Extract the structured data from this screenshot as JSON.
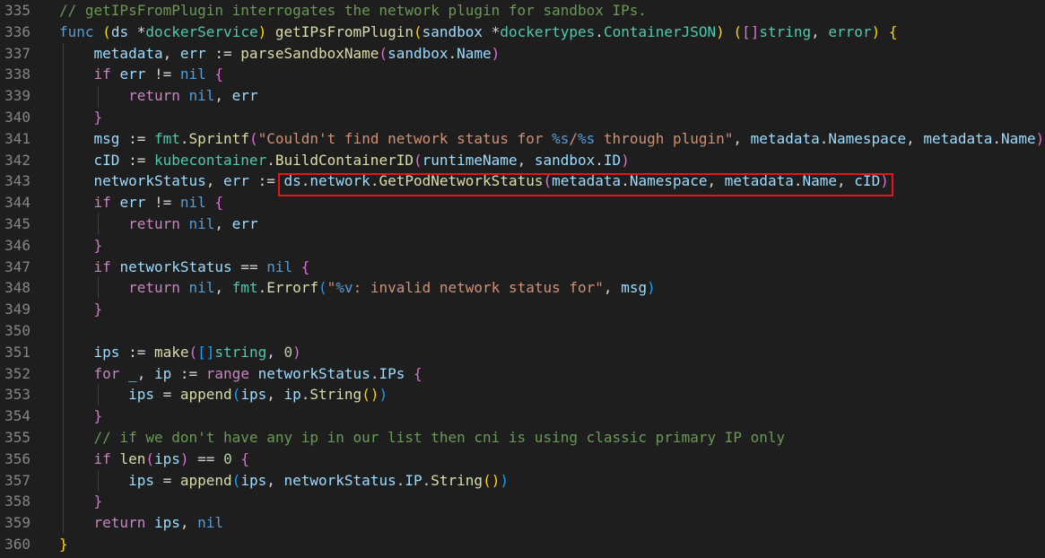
{
  "colors": {
    "background": "#1e1e1e",
    "line_number": "#858585",
    "keyword": "#569cd6",
    "control": "#c586c0",
    "function": "#dcdcaa",
    "variable": "#9cdcfe",
    "type": "#4ec9b0",
    "string": "#ce9178",
    "number": "#b5cea8",
    "comment": "#6a9955",
    "highlight_box": "#e3141b"
  },
  "lines": [
    {
      "n": "335",
      "indent": 0,
      "tokens": [
        [
          "// getIPsFromPlugin interrogates the network plugin for sandbox IPs.",
          "cmt"
        ]
      ]
    },
    {
      "n": "336",
      "indent": 0,
      "tokens": [
        [
          "func",
          "kw"
        ],
        [
          " ",
          ""
        ],
        [
          "(",
          "b1"
        ],
        [
          "ds ",
          "var"
        ],
        [
          "*",
          "op"
        ],
        [
          "dockerService",
          "type"
        ],
        [
          "",
          "b1"
        ],
        [
          ") ",
          "b1"
        ],
        [
          "getIPsFromPlugin",
          "fn"
        ],
        [
          "(",
          "b1"
        ],
        [
          "sandbox ",
          "var"
        ],
        [
          "*",
          "op"
        ],
        [
          "dockertypes",
          "type"
        ],
        [
          ".",
          "op"
        ],
        [
          "ContainerJSON",
          "type"
        ],
        [
          ") ",
          "b1"
        ],
        [
          "(",
          "b1"
        ],
        [
          "[]",
          "b2"
        ],
        [
          "string",
          "type"
        ],
        [
          ", ",
          "op"
        ],
        [
          "error",
          "type"
        ],
        [
          ") ",
          "b1"
        ],
        [
          "{",
          "b1"
        ]
      ]
    },
    {
      "n": "337",
      "indent": 1,
      "tokens": [
        [
          "metadata",
          "var"
        ],
        [
          ", ",
          "op"
        ],
        [
          "err",
          "var"
        ],
        [
          " := ",
          "op"
        ],
        [
          "parseSandboxName",
          "fn"
        ],
        [
          "(",
          "b2"
        ],
        [
          "sandbox",
          "var"
        ],
        [
          ".",
          "op"
        ],
        [
          "Name",
          "var"
        ],
        [
          ")",
          "b2"
        ]
      ]
    },
    {
      "n": "338",
      "indent": 1,
      "tokens": [
        [
          "if",
          "ctl"
        ],
        [
          " ",
          ""
        ],
        [
          "err",
          "var"
        ],
        [
          " != ",
          "op"
        ],
        [
          "nil",
          "kw"
        ],
        [
          " ",
          ""
        ],
        [
          "{",
          "b2"
        ]
      ]
    },
    {
      "n": "339",
      "indent": 2,
      "tokens": [
        [
          "return",
          "ctl"
        ],
        [
          " ",
          ""
        ],
        [
          "nil",
          "kw"
        ],
        [
          ", ",
          "op"
        ],
        [
          "err",
          "var"
        ]
      ]
    },
    {
      "n": "340",
      "indent": 1,
      "tokens": [
        [
          "}",
          "b2"
        ]
      ]
    },
    {
      "n": "341",
      "indent": 1,
      "tokens": [
        [
          "msg",
          "var"
        ],
        [
          " := ",
          "op"
        ],
        [
          "fmt",
          "type"
        ],
        [
          ".",
          "op"
        ],
        [
          "Sprintf",
          "fn"
        ],
        [
          "(",
          "b2"
        ],
        [
          "\"Couldn't find network status for ",
          "str"
        ],
        [
          "%s",
          "fmt"
        ],
        [
          "/",
          "str"
        ],
        [
          "%s",
          "fmt"
        ],
        [
          " through plugin\"",
          "str"
        ],
        [
          ", ",
          "op"
        ],
        [
          "metadata",
          "var"
        ],
        [
          ".",
          "op"
        ],
        [
          "Namespace",
          "var"
        ],
        [
          ", ",
          "op"
        ],
        [
          "metadata",
          "var"
        ],
        [
          ".",
          "op"
        ],
        [
          "Name",
          "var"
        ],
        [
          ")",
          "b2"
        ]
      ]
    },
    {
      "n": "342",
      "indent": 1,
      "tokens": [
        [
          "cID",
          "var"
        ],
        [
          " := ",
          "op"
        ],
        [
          "kubecontainer",
          "type"
        ],
        [
          ".",
          "op"
        ],
        [
          "BuildContainerID",
          "fn"
        ],
        [
          "(",
          "b2"
        ],
        [
          "runtimeName",
          "var"
        ],
        [
          ", ",
          "op"
        ],
        [
          "sandbox",
          "var"
        ],
        [
          ".",
          "op"
        ],
        [
          "ID",
          "var"
        ],
        [
          ")",
          "b2"
        ]
      ]
    },
    {
      "n": "343",
      "indent": 1,
      "tokens": [
        [
          "networkStatus",
          "var"
        ],
        [
          ", ",
          "op"
        ],
        [
          "err",
          "var"
        ],
        [
          " := ",
          "op"
        ],
        [
          "ds",
          "var"
        ],
        [
          ".",
          "op"
        ],
        [
          "network",
          "var"
        ],
        [
          ".",
          "op"
        ],
        [
          "GetPodNetworkStatus",
          "fn"
        ],
        [
          "(",
          "b2"
        ],
        [
          "metadata",
          "var"
        ],
        [
          ".",
          "op"
        ],
        [
          "Namespace",
          "var"
        ],
        [
          ", ",
          "op"
        ],
        [
          "metadata",
          "var"
        ],
        [
          ".",
          "op"
        ],
        [
          "Name",
          "var"
        ],
        [
          ", ",
          "op"
        ],
        [
          "cID",
          "var"
        ],
        [
          ")",
          "b2"
        ]
      ]
    },
    {
      "n": "344",
      "indent": 1,
      "tokens": [
        [
          "if",
          "ctl"
        ],
        [
          " ",
          ""
        ],
        [
          "err",
          "var"
        ],
        [
          " != ",
          "op"
        ],
        [
          "nil",
          "kw"
        ],
        [
          " ",
          ""
        ],
        [
          "{",
          "b2"
        ]
      ]
    },
    {
      "n": "345",
      "indent": 2,
      "tokens": [
        [
          "return",
          "ctl"
        ],
        [
          " ",
          ""
        ],
        [
          "nil",
          "kw"
        ],
        [
          ", ",
          "op"
        ],
        [
          "err",
          "var"
        ]
      ]
    },
    {
      "n": "346",
      "indent": 1,
      "tokens": [
        [
          "}",
          "b2"
        ]
      ]
    },
    {
      "n": "347",
      "indent": 1,
      "tokens": [
        [
          "if",
          "ctl"
        ],
        [
          " ",
          ""
        ],
        [
          "networkStatus",
          "var"
        ],
        [
          " == ",
          "op"
        ],
        [
          "nil",
          "kw"
        ],
        [
          " ",
          ""
        ],
        [
          "{",
          "b2"
        ]
      ]
    },
    {
      "n": "348",
      "indent": 2,
      "tokens": [
        [
          "return",
          "ctl"
        ],
        [
          " ",
          ""
        ],
        [
          "nil",
          "kw"
        ],
        [
          ", ",
          "op"
        ],
        [
          "fmt",
          "type"
        ],
        [
          ".",
          "op"
        ],
        [
          "Errorf",
          "fn"
        ],
        [
          "(",
          "b3"
        ],
        [
          "\"",
          "str"
        ],
        [
          "%v",
          "fmt"
        ],
        [
          ": invalid network status for\"",
          "str"
        ],
        [
          ", ",
          "op"
        ],
        [
          "msg",
          "var"
        ],
        [
          ")",
          "b3"
        ]
      ]
    },
    {
      "n": "349",
      "indent": 1,
      "tokens": [
        [
          "}",
          "b2"
        ]
      ]
    },
    {
      "n": "350",
      "indent": 1,
      "tokens": []
    },
    {
      "n": "351",
      "indent": 1,
      "tokens": [
        [
          "ips",
          "var"
        ],
        [
          " := ",
          "op"
        ],
        [
          "make",
          "fn"
        ],
        [
          "(",
          "b2"
        ],
        [
          "[]",
          "b3"
        ],
        [
          "string",
          "type"
        ],
        [
          ", ",
          "op"
        ],
        [
          "0",
          "num"
        ],
        [
          ")",
          "b2"
        ]
      ]
    },
    {
      "n": "352",
      "indent": 1,
      "tokens": [
        [
          "for",
          "ctl"
        ],
        [
          " ",
          ""
        ],
        [
          "_",
          "var"
        ],
        [
          ", ",
          "op"
        ],
        [
          "ip",
          "var"
        ],
        [
          " := ",
          "op"
        ],
        [
          "range",
          "ctl"
        ],
        [
          " ",
          ""
        ],
        [
          "networkStatus",
          "var"
        ],
        [
          ".",
          "op"
        ],
        [
          "IPs",
          "var"
        ],
        [
          " ",
          ""
        ],
        [
          "{",
          "b2"
        ]
      ]
    },
    {
      "n": "353",
      "indent": 2,
      "tokens": [
        [
          "ips",
          "var"
        ],
        [
          " = ",
          "op"
        ],
        [
          "append",
          "fn"
        ],
        [
          "(",
          "b3"
        ],
        [
          "ips",
          "var"
        ],
        [
          ", ",
          "op"
        ],
        [
          "ip",
          "var"
        ],
        [
          ".",
          "op"
        ],
        [
          "String",
          "fn"
        ],
        [
          "()",
          "b1"
        ],
        [
          ")",
          "b3"
        ]
      ]
    },
    {
      "n": "354",
      "indent": 1,
      "tokens": [
        [
          "}",
          "b2"
        ]
      ]
    },
    {
      "n": "355",
      "indent": 1,
      "tokens": [
        [
          "// if we don't have any ip in our list then cni is using classic primary IP only",
          "cmt"
        ]
      ]
    },
    {
      "n": "356",
      "indent": 1,
      "tokens": [
        [
          "if",
          "ctl"
        ],
        [
          " ",
          ""
        ],
        [
          "len",
          "fn"
        ],
        [
          "(",
          "b2"
        ],
        [
          "ips",
          "var"
        ],
        [
          ")",
          "b2"
        ],
        [
          " == ",
          "op"
        ],
        [
          "0",
          "num"
        ],
        [
          " ",
          ""
        ],
        [
          "{",
          "b2"
        ]
      ]
    },
    {
      "n": "357",
      "indent": 2,
      "tokens": [
        [
          "ips",
          "var"
        ],
        [
          " = ",
          "op"
        ],
        [
          "append",
          "fn"
        ],
        [
          "(",
          "b3"
        ],
        [
          "ips",
          "var"
        ],
        [
          ", ",
          "op"
        ],
        [
          "networkStatus",
          "var"
        ],
        [
          ".",
          "op"
        ],
        [
          "IP",
          "var"
        ],
        [
          ".",
          "op"
        ],
        [
          "String",
          "fn"
        ],
        [
          "()",
          "b1"
        ],
        [
          ")",
          "b3"
        ]
      ]
    },
    {
      "n": "358",
      "indent": 1,
      "tokens": [
        [
          "}",
          "b2"
        ]
      ]
    },
    {
      "n": "359",
      "indent": 1,
      "tokens": [
        [
          "return",
          "ctl"
        ],
        [
          " ",
          ""
        ],
        [
          "ips",
          "var"
        ],
        [
          ", ",
          "op"
        ],
        [
          "nil",
          "kw"
        ]
      ]
    },
    {
      "n": "360",
      "indent": 0,
      "tokens": [
        [
          "}",
          "b1"
        ]
      ]
    }
  ]
}
